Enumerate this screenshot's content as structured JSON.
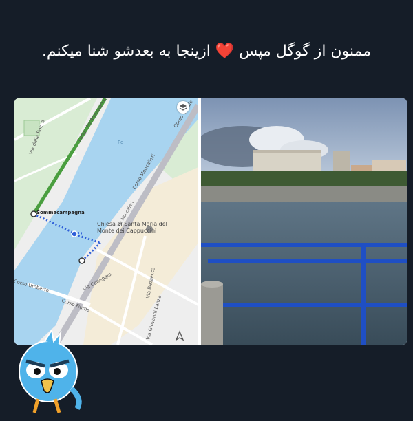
{
  "post": {
    "caption": "ممنون از گوگل مپس ❤️ ازینجا به بعدشو شنا میکنم."
  },
  "map": {
    "labels": {
      "sommacampagna": "Sommacampagna",
      "church_line1": "Chiesa di Santa Maria del",
      "church_line2": "Monte dei Cappuccini",
      "lungo_po": "Lungo Po Armando Diaz",
      "corso_moncalieri": "Corso Moncalieri",
      "corso_casale": "Corso Casale",
      "corso_fiume": "Corso Fiume",
      "via_catleggio": "Via Catleggio",
      "via_giovanni_lanza": "Via Giovanni Lanza",
      "via_bezzecca": "Via Bezzecca",
      "via_della_rocca": "Via della Rocca",
      "corso_umberto": "Corso Umberto",
      "via_moncalieri": "Via Moncalieri",
      "po": "Po"
    }
  },
  "colors": {
    "background": "#151d28",
    "caption": "#ffffff",
    "heart": "#e23b3b",
    "river": "#a8d4f0",
    "route": "#2f5fd8",
    "railing": "#1f4fc4"
  }
}
